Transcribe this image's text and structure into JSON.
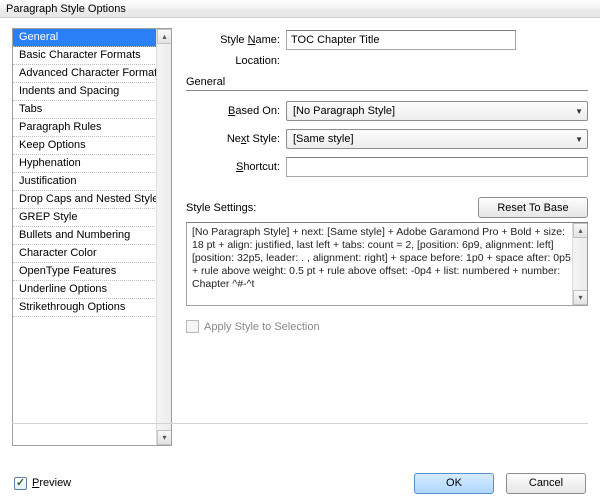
{
  "window": {
    "title": "Paragraph Style Options"
  },
  "sidebar": {
    "items": [
      {
        "label": "General",
        "selected": true
      },
      {
        "label": "Basic Character Formats"
      },
      {
        "label": "Advanced Character Formats"
      },
      {
        "label": "Indents and Spacing"
      },
      {
        "label": "Tabs"
      },
      {
        "label": "Paragraph Rules"
      },
      {
        "label": "Keep Options"
      },
      {
        "label": "Hyphenation"
      },
      {
        "label": "Justification"
      },
      {
        "label": "Drop Caps and Nested Styles"
      },
      {
        "label": "GREP Style"
      },
      {
        "label": "Bullets and Numbering"
      },
      {
        "label": "Character Color"
      },
      {
        "label": "OpenType Features"
      },
      {
        "label": "Underline Options"
      },
      {
        "label": "Strikethrough Options"
      }
    ]
  },
  "form": {
    "style_name_label": "Style Name:",
    "style_name_value": "TOC Chapter Title",
    "location_label": "Location:",
    "section_title": "General",
    "based_on_label": "Based On:",
    "based_on_value": "[No Paragraph Style]",
    "next_style_label": "Next Style:",
    "next_style_value": "[Same style]",
    "shortcut_label": "Shortcut:",
    "shortcut_value": "",
    "settings_label": "Style Settings:",
    "reset_btn": "Reset To Base",
    "settings_text": "[No Paragraph Style] + next: [Same style] + Adobe Garamond Pro + Bold + size: 18 pt + align: justified, last left + tabs: count = 2, [position: 6p9, alignment: left] [position: 32p5, leader: . , alignment: right]  + space before: 1p0 + space after: 0p5 + rule above weight: 0.5 pt + rule above offset: -0p4 +  list: numbered +  number: Chapter ^#-^t",
    "apply_label": "Apply Style to Selection"
  },
  "footer": {
    "preview_label": "Preview",
    "ok": "OK",
    "cancel": "Cancel"
  }
}
